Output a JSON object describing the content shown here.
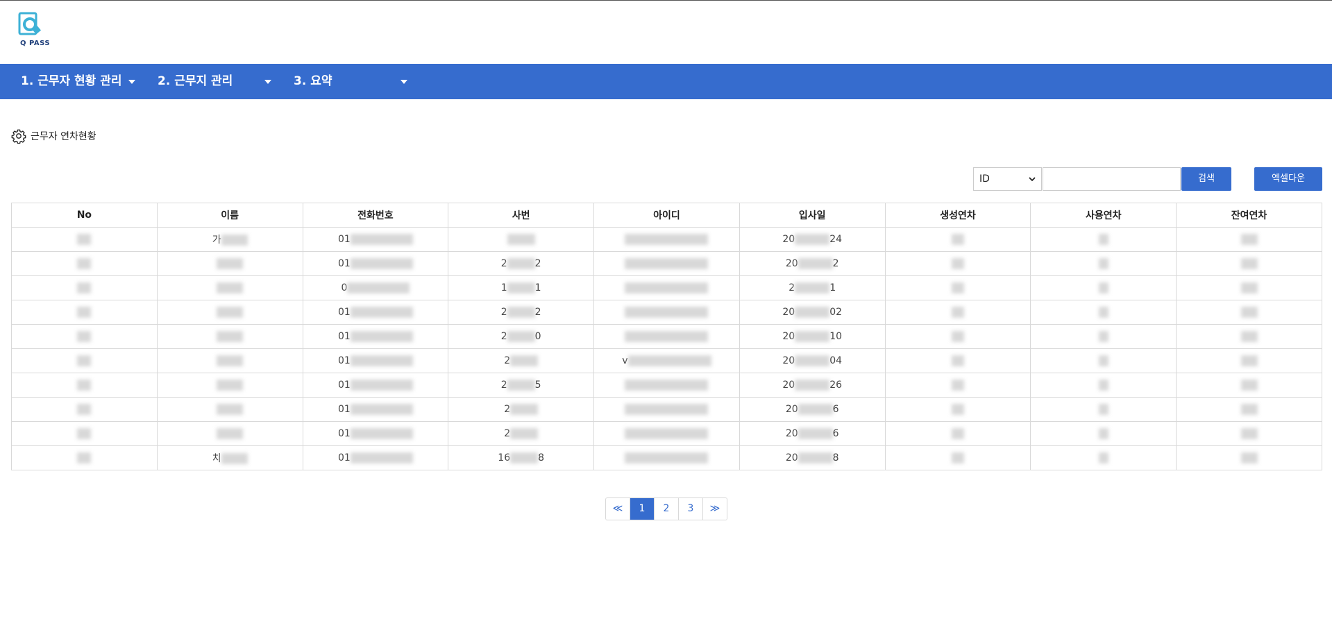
{
  "brand": {
    "logo_text": "Q PASS"
  },
  "nav": [
    {
      "label": "1. 근무자 현황 관리"
    },
    {
      "label": "2. 근무지 관리"
    },
    {
      "label": "3. 요약"
    }
  ],
  "section": {
    "title": "근무자 연차현황"
  },
  "search": {
    "field_selected": "ID",
    "input_value": "",
    "search_label": "검색",
    "excel_label": "엑셀다운"
  },
  "table": {
    "columns": [
      "No",
      "이름",
      "전화번호",
      "사번",
      "아이디",
      "입사일",
      "생성연차",
      "사용연차",
      "잔여연차"
    ],
    "rows": [
      [
        "",
        "가",
        "01",
        "",
        "",
        "20",
        "",
        "",
        ""
      ],
      [
        "",
        "",
        "01",
        "2",
        "",
        "20",
        "",
        "",
        ""
      ],
      [
        "",
        "",
        "0",
        "1",
        "",
        "2",
        "",
        "",
        ""
      ],
      [
        "",
        "",
        "01",
        "2",
        "",
        "20",
        "",
        "",
        ""
      ],
      [
        "",
        "",
        "01",
        "2",
        "",
        "20",
        "",
        "",
        ""
      ],
      [
        "",
        "",
        "01",
        "2",
        "v",
        "20",
        "",
        "",
        ""
      ],
      [
        "",
        "",
        "01",
        "2",
        "",
        "20",
        "",
        "",
        ""
      ],
      [
        "",
        "",
        "01",
        "2",
        "",
        "20",
        "",
        "",
        ""
      ],
      [
        "",
        "",
        "01",
        "2",
        "",
        "20",
        "",
        "",
        ""
      ],
      [
        "",
        "치",
        "01",
        "16",
        "",
        "20",
        "",
        "",
        ""
      ]
    ],
    "trailing": [
      [
        "",
        "",
        "",
        "",
        "",
        "24",
        "",
        "",
        ""
      ],
      [
        "",
        "",
        "",
        "2",
        "",
        "2",
        "",
        "",
        ""
      ],
      [
        "",
        "",
        "",
        "1",
        "",
        "1",
        "",
        "",
        ""
      ],
      [
        "",
        "",
        "",
        "2",
        "",
        "02",
        "",
        "",
        ""
      ],
      [
        "",
        "",
        "",
        "0",
        "",
        "10",
        "",
        "",
        ""
      ],
      [
        "",
        "",
        "",
        "",
        "",
        "04",
        "",
        "",
        ""
      ],
      [
        "",
        "",
        "",
        "5",
        "",
        "26",
        "",
        "",
        ""
      ],
      [
        "",
        "",
        "",
        "",
        "",
        "6",
        "",
        "",
        ""
      ],
      [
        "",
        "",
        "",
        "",
        "",
        "6",
        "",
        "",
        ""
      ],
      [
        "",
        "",
        "",
        "8",
        "",
        "8",
        "",
        "",
        ""
      ]
    ]
  },
  "pagination": {
    "prev": "≪",
    "next": "≫",
    "pages": [
      "1",
      "2",
      "3"
    ],
    "current": "1"
  }
}
